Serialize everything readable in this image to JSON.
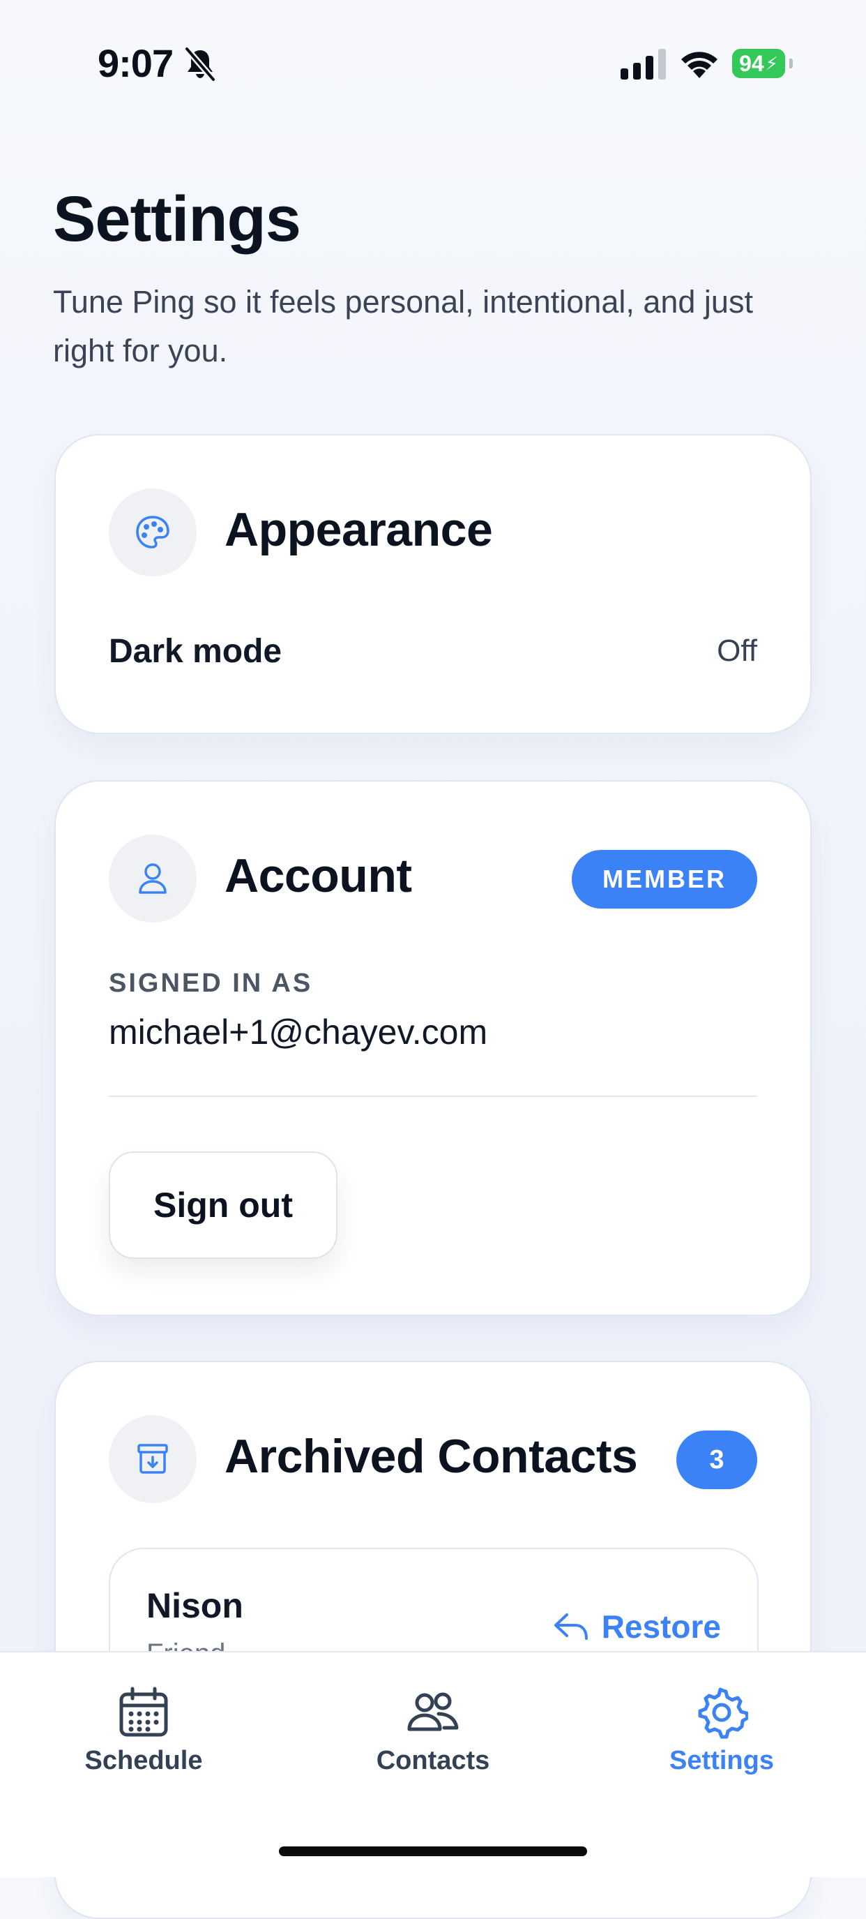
{
  "status_bar": {
    "time": "9:07",
    "battery": "94"
  },
  "header": {
    "title": "Settings",
    "subtitle": "Tune Ping so it feels personal, intentional, and just right for you."
  },
  "appearance": {
    "title": "Appearance",
    "icon": "palette-icon",
    "dark_mode_label": "Dark mode",
    "dark_mode_value": "Off"
  },
  "account": {
    "title": "Account",
    "icon": "user-icon",
    "badge": "MEMBER",
    "signed_in_label": "SIGNED IN AS",
    "email": "michael+1@chayev.com",
    "sign_out_label": "Sign out"
  },
  "archived": {
    "title": "Archived Contacts",
    "icon": "archive-icon",
    "count": "3",
    "contacts": [
      {
        "name": "Nison",
        "relation": "Friend",
        "action": "Restore"
      }
    ]
  },
  "tabs": [
    {
      "label": "Schedule",
      "icon": "calendar-icon",
      "active": false
    },
    {
      "label": "Contacts",
      "icon": "people-icon",
      "active": false
    },
    {
      "label": "Settings",
      "icon": "gear-icon",
      "active": true
    }
  ],
  "colors": {
    "accent": "#3b82f6",
    "battery": "#34c759",
    "text": "#0b1220"
  }
}
